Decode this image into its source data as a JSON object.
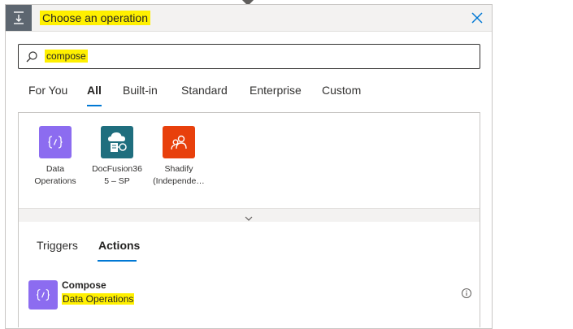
{
  "header": {
    "title": "Choose an operation",
    "icon": "insert-step-icon",
    "close_icon": "close-icon"
  },
  "search": {
    "value": "compose",
    "icon": "search-icon"
  },
  "tabs": [
    {
      "label": "For You"
    },
    {
      "label": "All",
      "active": true
    },
    {
      "label": "Built-in"
    },
    {
      "label": "Standard"
    },
    {
      "label": "Enterprise"
    },
    {
      "label": "Custom"
    }
  ],
  "connectors": [
    {
      "label": "Data\nOperations",
      "icon": "data-operations-icon",
      "color": "#8c6cf0"
    },
    {
      "label": "DocFusion36\n5 – SP",
      "icon": "docfusion-cloud-icon",
      "color": "#1f6e7e"
    },
    {
      "label": "Shadify\n(Independe…",
      "icon": "shadify-people-icon",
      "color": "#e8400c"
    }
  ],
  "expand": {
    "icon": "chevron-down-icon"
  },
  "subtabs": [
    {
      "label": "Triggers"
    },
    {
      "label": "Actions",
      "active": true
    }
  ],
  "results": [
    {
      "title": "Compose",
      "subtitle": "Data Operations",
      "icon": "data-operations-icon",
      "info_icon": "info-icon",
      "color": "#8c6cf0"
    }
  ],
  "colors": {
    "accent": "#0078d4",
    "highlight": "#fff000",
    "header_icon_bg": "#5d6670"
  }
}
